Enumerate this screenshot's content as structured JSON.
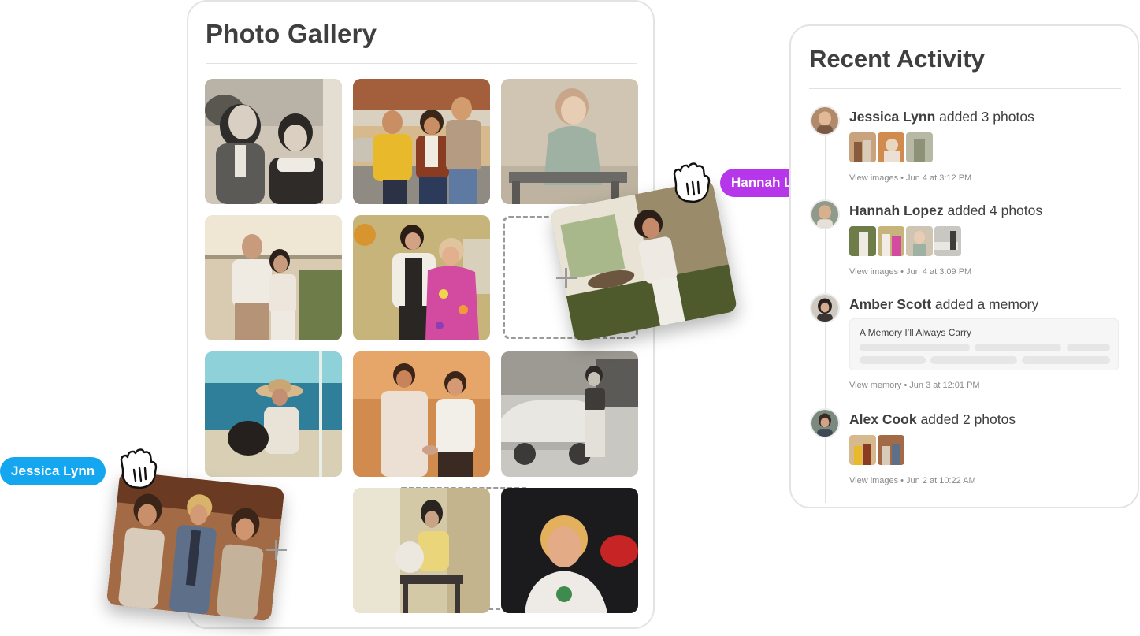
{
  "gallery": {
    "title": "Photo Gallery",
    "photos": [
      {
        "name": "photo-sepia-siblings"
      },
      {
        "name": "photo-three-friends-parking-lot"
      },
      {
        "name": "photo-toddler-on-bench"
      },
      {
        "name": "photo-couple-on-porch"
      },
      {
        "name": "photo-two-women-party"
      },
      {
        "name": "photo-woman-hat-beach"
      },
      {
        "name": "photo-couple-wedding-cake"
      },
      {
        "name": "photo-woman-by-vintage-car"
      },
      {
        "name": "photo-woman-holding-cat"
      },
      {
        "name": "photo-woman-smiling-portrait"
      }
    ]
  },
  "collaborators": {
    "hannah": {
      "label": "Hannah Lopez",
      "color": "#b637ea"
    },
    "jessica": {
      "label": "Jessica Lynn",
      "color": "#14a7ef"
    }
  },
  "activity": {
    "title": "Recent Activity",
    "entries": [
      {
        "name": "Jessica Lynn",
        "action": "added 3 photos",
        "link": "View images",
        "time": "Jun 4 at 3:12 PM"
      },
      {
        "name": "Hannah Lopez",
        "action": "added 4 photos",
        "link": "View images",
        "time": "Jun 4 at 3:09 PM"
      },
      {
        "name": "Amber Scott",
        "action": "added a memory",
        "memory_title": "A Memory I’ll Always Carry",
        "link": "View memory",
        "time": "Jun 3 at 12:01 PM"
      },
      {
        "name": "Alex Cook",
        "action": "added 2 photos",
        "link": "View images",
        "time": "Jun 2 at 10:22 AM"
      }
    ],
    "separator": "•"
  }
}
